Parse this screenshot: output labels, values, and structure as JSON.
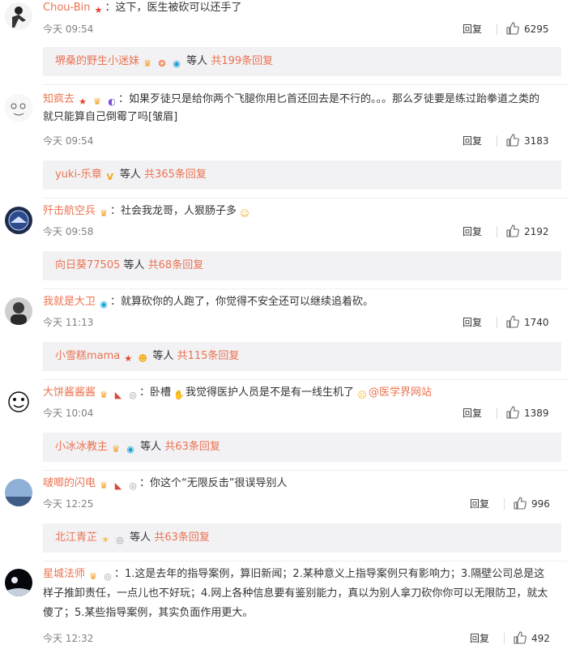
{
  "ui": {
    "reply_label": "回复",
    "etc_label": "等人"
  },
  "colors": {
    "name": "#eb7350",
    "reply_bg": "#f2f2f5",
    "meta": "#808080"
  },
  "comments": [
    {
      "user": "Chou-Bin",
      "text": "：这下，医生被砍可以还手了",
      "time": "今天 09:54",
      "likes": "6295",
      "reply_user": "堺桑的野生小迷妹",
      "reply_total": "共199条回复",
      "avatar_icon": "figure-avatar"
    },
    {
      "user": "知疯去",
      "text": "：如果歹徒只是给你两个飞腿你用匕首还回去是不行的。。。那么歹徒要是练过跆拳道之类的就只能算自己倒霉了吗[皱眉]",
      "time": "今天 09:54",
      "likes": "3183",
      "reply_user": "yuki-乐章",
      "reply_total": "共365条回复",
      "avatar_icon": "drawing-avatar"
    },
    {
      "user": "歼击航空兵",
      "text": "：社会我龙哥，人狠肠子多",
      "time": "今天 09:58",
      "likes": "2192",
      "reply_user": "向日葵77505",
      "reply_total": "共68条回复",
      "avatar_icon": "emblem-avatar"
    },
    {
      "user": "我就是大卫",
      "text": "：就算砍你的人跑了，你觉得不安全还可以继续追着砍。",
      "time": "今天 11:13",
      "likes": "1740",
      "reply_user": "小雪糕mama",
      "reply_total": "共115条回复",
      "avatar_icon": "person-avatar"
    },
    {
      "user": "大饼酱酱酱",
      "text_before": "：卧槽",
      "text": "我觉得医护人员是不是有一线生机了",
      "link": "@医学界网站",
      "time": "今天 10:04",
      "likes": "1389",
      "reply_user": "小冰冰教主",
      "reply_total": "共63条回复",
      "avatar_icon": "cartoon-avatar"
    },
    {
      "user": "啵唧的闪电",
      "text": "：你这个“无限反击”很误导别人",
      "time": "今天 12:25",
      "likes": "996",
      "reply_user": "北江青芷",
      "reply_total": "共63条回复",
      "avatar_icon": "sky-avatar"
    },
    {
      "user": "星城法师",
      "text": "：1.这是去年的指导案例，算旧新闻；2.某种意义上指导案例只有影响力；3.隔壁公司总是这样子推卸责任，一点儿也不好玩；4.网上各种信息要有鉴别能力，真以为别人拿刀砍你你可以无限防卫，就太傻了；5.某些指导案例，其实负面作用更大。",
      "time": "今天 12:32",
      "likes": "492",
      "avatar_icon": "space-avatar"
    }
  ]
}
